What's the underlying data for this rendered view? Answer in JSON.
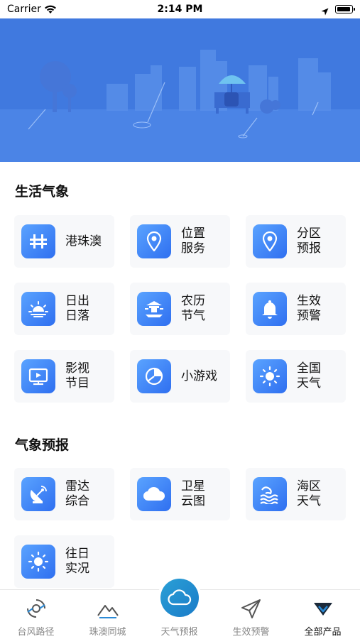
{
  "status_bar": {
    "carrier": "Carrier",
    "time": "2:14 PM",
    "wifi_icon": "wifi-icon",
    "location_icon": "location-arrow-icon",
    "battery_icon": "battery-icon"
  },
  "banner": {
    "illustration": "city-park-rain-illustration",
    "color": "#4a80e3"
  },
  "life_weather": {
    "title": "生活气象",
    "items": [
      {
        "icon": "hzm-bridge-icon",
        "line1": "港珠澳",
        "line2": ""
      },
      {
        "icon": "location-pin-icon",
        "line1": "位置",
        "line2": "服务"
      },
      {
        "icon": "location-pin-icon",
        "line1": "分区",
        "line2": "预报"
      },
      {
        "icon": "sunrise-icon",
        "line1": "日出",
        "line2": "日落"
      },
      {
        "icon": "temple-icon",
        "line1": "农历",
        "line2": "节气"
      },
      {
        "icon": "bell-icon",
        "line1": "生效",
        "line2": "预警"
      },
      {
        "icon": "tv-icon",
        "line1": "影视",
        "line2": "节目"
      },
      {
        "icon": "pie-game-icon",
        "line1": "小游戏",
        "line2": ""
      },
      {
        "icon": "sun-icon",
        "line1": "全国",
        "line2": "天气"
      }
    ]
  },
  "forecast": {
    "title": "气象预报",
    "items": [
      {
        "icon": "radar-dish-icon",
        "line1": "雷达",
        "line2": "综合"
      },
      {
        "icon": "cloud-icon",
        "line1": "卫星",
        "line2": "云图"
      },
      {
        "icon": "waves-icon",
        "line1": "海区",
        "line2": "天气"
      },
      {
        "icon": "sun-icon",
        "line1": "往日",
        "line2": "实况"
      }
    ]
  },
  "tab_bar": {
    "tabs": [
      {
        "icon": "typhoon-icon",
        "label": "台风路径",
        "active": false
      },
      {
        "icon": "mountain-icon",
        "label": "珠澳同城",
        "active": false
      },
      {
        "icon": "cloud-icon",
        "label": "天气预报",
        "active": false
      },
      {
        "icon": "paper-plane-icon",
        "label": "生效预警",
        "active": false
      },
      {
        "icon": "all-products-icon",
        "label": "全部产品",
        "active": true
      }
    ],
    "accent_color": "#1a7bc8"
  }
}
